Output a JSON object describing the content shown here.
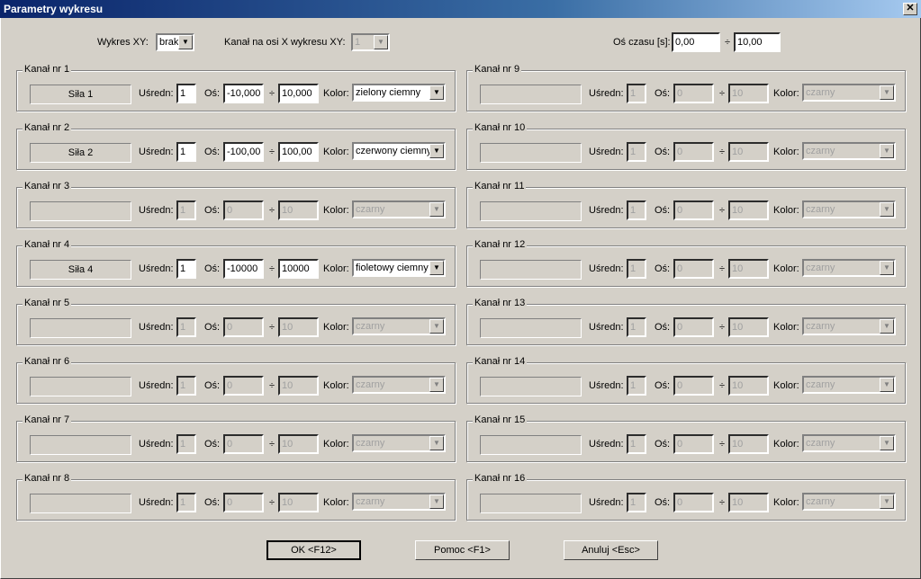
{
  "window": {
    "title": "Parametry wykresu",
    "close_glyph": "✕"
  },
  "top": {
    "xy_label": "Wykres XY:",
    "xy_value": "brak",
    "xaxis_label": "Kanał na osi X wykresu XY:",
    "xaxis_value": "1",
    "time_label": "Oś czasu [s]:",
    "time_from": "0,00",
    "time_sep": "÷",
    "time_to": "10,00"
  },
  "labels": {
    "avg": "Uśredn:",
    "axis": "Oś:",
    "sep": "÷",
    "color": "Kolor:"
  },
  "channels": [
    {
      "title": "Kanał nr 1",
      "name": "Siła 1",
      "avg": "1",
      "min": "-10,000",
      "max": "10,000",
      "color": "zielony ciemny",
      "enabled": true
    },
    {
      "title": "Kanał nr 2",
      "name": "Siła 2",
      "avg": "1",
      "min": "-100,00",
      "max": "100,00",
      "color": "czerwony ciemny",
      "enabled": true
    },
    {
      "title": "Kanał nr 3",
      "name": "",
      "avg": "1",
      "min": "0",
      "max": "10",
      "color": "czarny",
      "enabled": false
    },
    {
      "title": "Kanał nr 4",
      "name": "Siła 4",
      "avg": "1",
      "min": "-10000",
      "max": "10000",
      "color": "fioletowy ciemny",
      "enabled": true
    },
    {
      "title": "Kanał nr 5",
      "name": "",
      "avg": "1",
      "min": "0",
      "max": "10",
      "color": "czarny",
      "enabled": false
    },
    {
      "title": "Kanał nr 6",
      "name": "",
      "avg": "1",
      "min": "0",
      "max": "10",
      "color": "czarny",
      "enabled": false
    },
    {
      "title": "Kanał nr 7",
      "name": "",
      "avg": "1",
      "min": "0",
      "max": "10",
      "color": "czarny",
      "enabled": false
    },
    {
      "title": "Kanał nr 8",
      "name": "",
      "avg": "1",
      "min": "0",
      "max": "10",
      "color": "czarny",
      "enabled": false
    },
    {
      "title": "Kanał nr 9",
      "name": "",
      "avg": "1",
      "min": "0",
      "max": "10",
      "color": "czarny",
      "enabled": false
    },
    {
      "title": "Kanał nr 10",
      "name": "",
      "avg": "1",
      "min": "0",
      "max": "10",
      "color": "czarny",
      "enabled": false
    },
    {
      "title": "Kanał nr 11",
      "name": "",
      "avg": "1",
      "min": "0",
      "max": "10",
      "color": "czarny",
      "enabled": false
    },
    {
      "title": "Kanał nr 12",
      "name": "",
      "avg": "1",
      "min": "0",
      "max": "10",
      "color": "czarny",
      "enabled": false
    },
    {
      "title": "Kanał nr 13",
      "name": "",
      "avg": "1",
      "min": "0",
      "max": "10",
      "color": "czarny",
      "enabled": false
    },
    {
      "title": "Kanał nr 14",
      "name": "",
      "avg": "1",
      "min": "0",
      "max": "10",
      "color": "czarny",
      "enabled": false
    },
    {
      "title": "Kanał nr 15",
      "name": "",
      "avg": "1",
      "min": "0",
      "max": "10",
      "color": "czarny",
      "enabled": false
    },
    {
      "title": "Kanał nr 16",
      "name": "",
      "avg": "1",
      "min": "0",
      "max": "10",
      "color": "czarny",
      "enabled": false
    }
  ],
  "buttons": {
    "ok": "OK  <F12>",
    "help": "Pomoc  <F1>",
    "cancel": "Anuluj  <Esc>"
  }
}
